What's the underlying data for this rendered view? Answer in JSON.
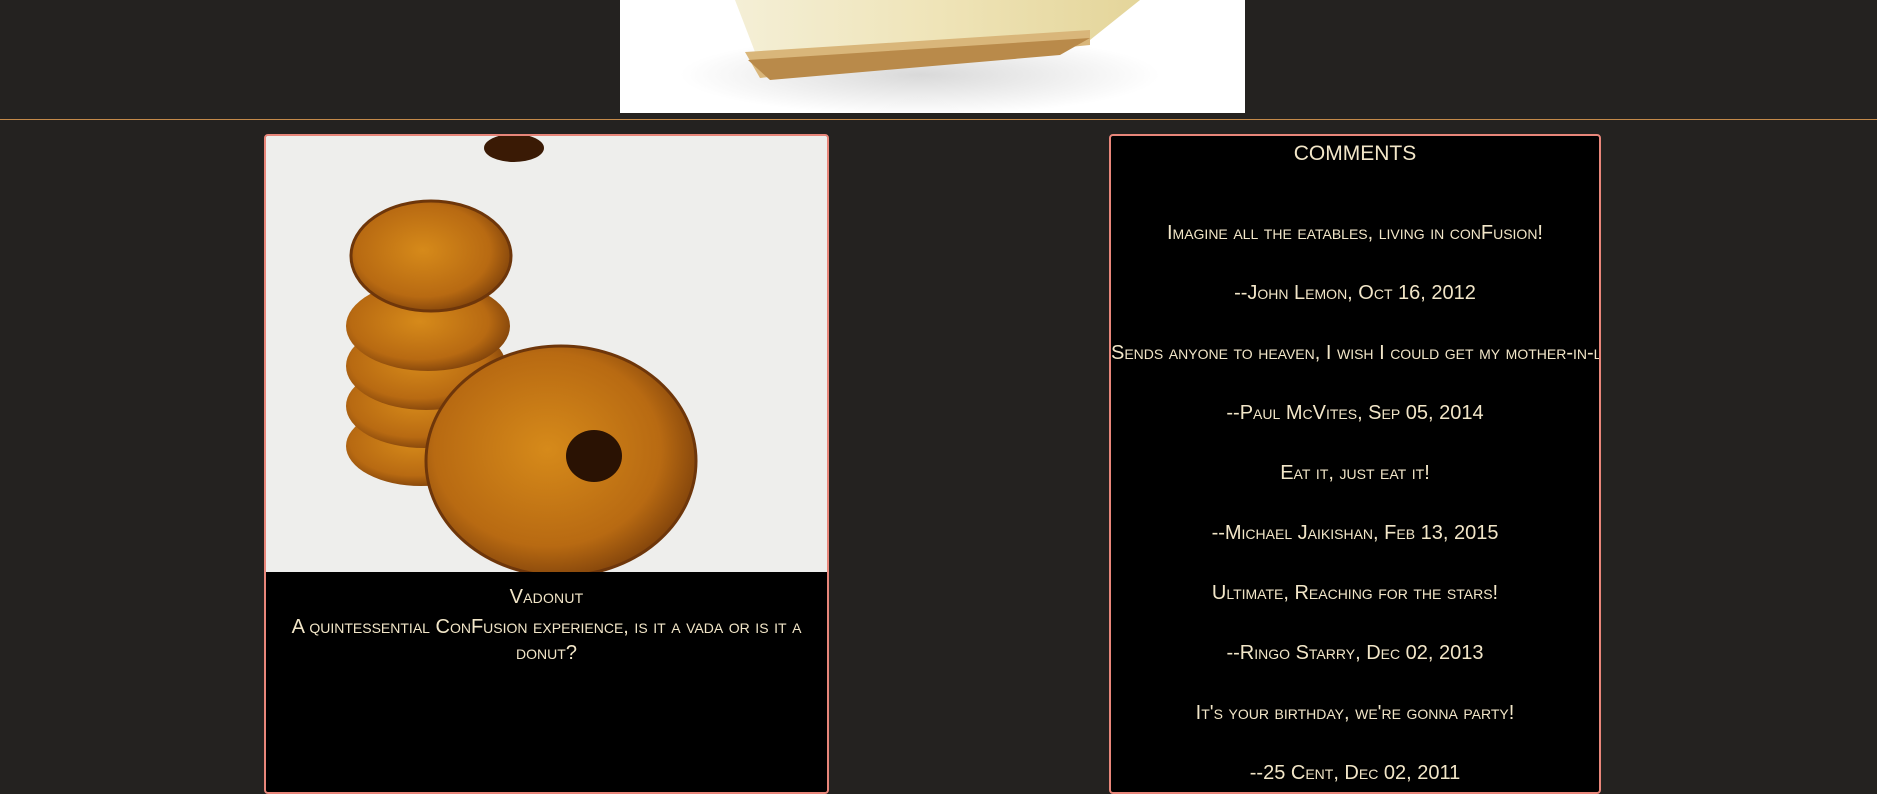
{
  "top_image": {
    "alt": "Cheesecake slice",
    "icon": "cake-photo"
  },
  "dish": {
    "name": "Vadonut",
    "description": "A quintessential ConFusion experience, is it a vada or is it a donut?",
    "image_icon": "donut-stack-photo"
  },
  "comments": {
    "title": "COMMENTS",
    "items": [
      {
        "text": "Imagine all the eatables, living in conFusion!",
        "author": "--John Lemon, Oct 16, 2012"
      },
      {
        "text": "Sends anyone to heaven, I wish I could get my mother-in-law to eat it!",
        "author": "--Paul McVites, Sep 05, 2014"
      },
      {
        "text": "Eat it, just eat it!",
        "author": "--Michael Jaikishan, Feb 13, 2015"
      },
      {
        "text": "Ultimate, Reaching for the stars!",
        "author": "--Ringo Starry, Dec 02, 2013"
      },
      {
        "text": "It's your birthday, we're gonna party!",
        "author": "--25 Cent, Dec 02, 2011"
      }
    ]
  },
  "colors": {
    "page_bg": "#242220",
    "card_bg": "#000000",
    "card_border": "#e8867a",
    "text": "#f2e6c8",
    "divider": "#c48a4a"
  }
}
